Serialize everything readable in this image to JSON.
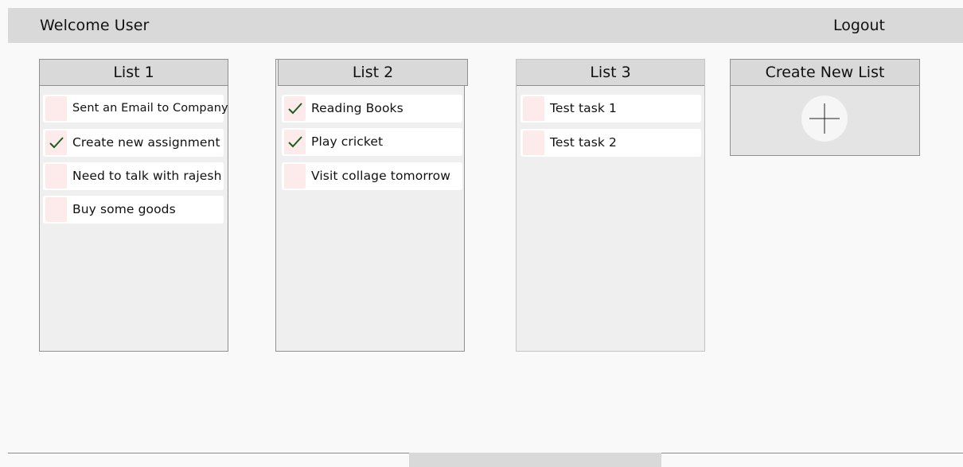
{
  "header": {
    "welcome": "Welcome User",
    "logout": "Logout"
  },
  "lists": [
    {
      "title": "List 1",
      "tasks": [
        {
          "text": "Sent an Email to Company",
          "done": false
        },
        {
          "text": "Create new assignment",
          "done": true
        },
        {
          "text": "Need to talk with rajesh",
          "done": false
        },
        {
          "text": "Buy some goods",
          "done": false
        }
      ]
    },
    {
      "title": "List 2",
      "tasks": [
        {
          "text": "Reading Books",
          "done": true
        },
        {
          "text": "Play cricket",
          "done": true
        },
        {
          "text": "Visit collage tomorrow",
          "done": false
        }
      ]
    },
    {
      "title": "List 3",
      "tasks": [
        {
          "text": "Test task 1",
          "done": false
        },
        {
          "text": "Test task 2",
          "done": false
        }
      ]
    }
  ],
  "create_list": {
    "title": "Create New List",
    "icon": "plus-icon"
  },
  "colors": {
    "header_bg": "#d9d9d9",
    "panel_bg": "#efefef",
    "checkbox_bg": "#fdebeb",
    "check_color": "#1e5c1e"
  }
}
